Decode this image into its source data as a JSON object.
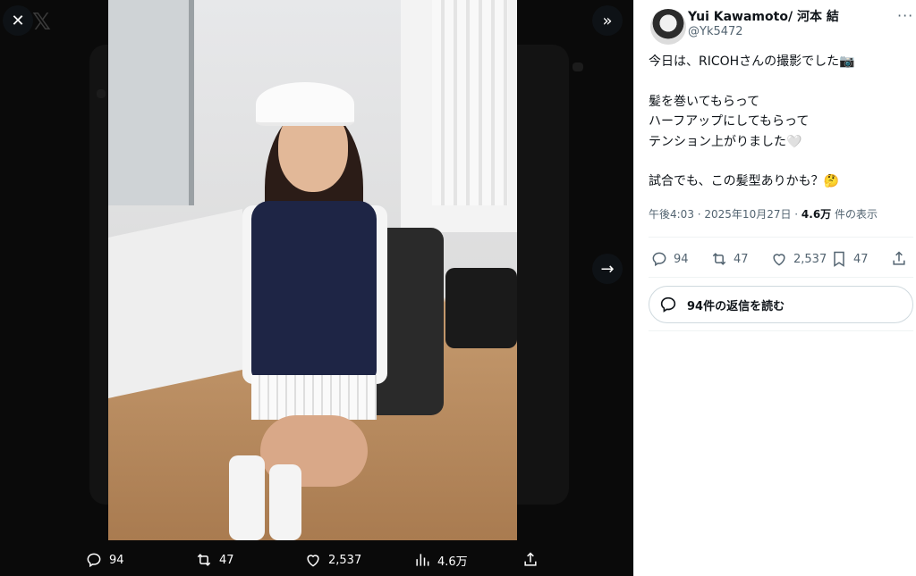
{
  "author": {
    "name": "Yui Kawamoto/ 河本 結",
    "handle": "@Yk5472"
  },
  "tweet": {
    "lines": [
      "今日は、RICOHさんの撮影でした📷",
      "",
      "髪を巻いてもらって",
      "ハーフアップにしてもらって",
      "テンション上がりました🤍",
      "",
      "試合でも、この髪型ありかも？🤔"
    ],
    "time": "午後4:03 · 2025年10月27日 · ",
    "views": "4.6万",
    "views_suffix": " 件の表示"
  },
  "actions": {
    "replies": "94",
    "reposts": "47",
    "likes": "2,537",
    "bookmarks": "47"
  },
  "read_replies_label": "94件の返信を読む",
  "viewer_bar": {
    "replies": "94",
    "reposts": "47",
    "likes": "2,537",
    "views": "4.6万"
  },
  "icons": [
    "close-icon",
    "x-logo-icon",
    "collapse-panel-icon",
    "next-arrow-icon",
    "reply-icon",
    "repost-icon",
    "like-icon",
    "views-icon",
    "bookmark-icon",
    "share-icon",
    "more-icon"
  ]
}
